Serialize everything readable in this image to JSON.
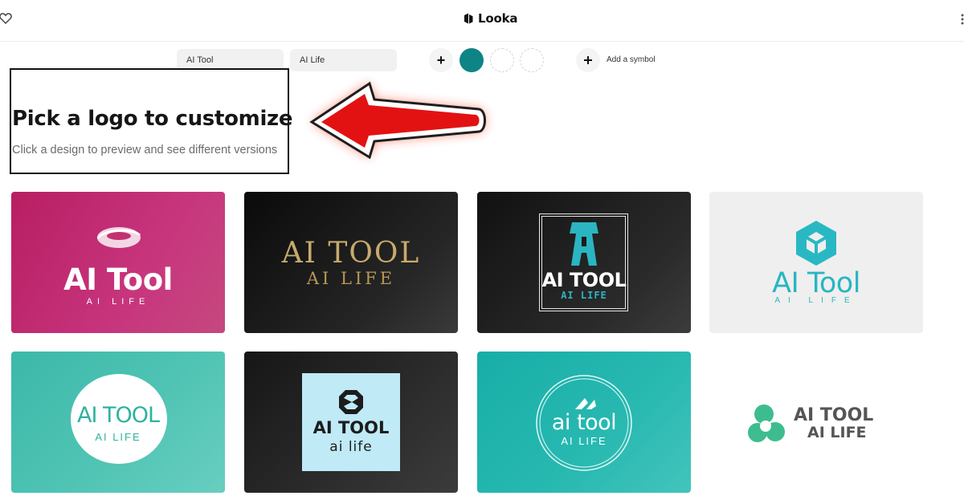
{
  "app": {
    "brand": "Looka"
  },
  "filters": {
    "company_name": "AI Tool",
    "slogan": "AI Life",
    "add_color_label": "+",
    "selected_color": "#0e8485",
    "add_symbol_label": "Add a symbol"
  },
  "heading": {
    "title": "Pick a logo to customize",
    "subtitle": "Click a design to preview and see different versions"
  },
  "annotation": {
    "arrow_color": "#e31212"
  },
  "logos": [
    {
      "name": "AI Tool",
      "tagline": "AI LIFE",
      "background": "#b81e62"
    },
    {
      "name": "AI TOOL",
      "tagline": "AI LIFE",
      "background": "#111111"
    },
    {
      "name": "AI TOOL",
      "tagline": "AI LIFE",
      "background": "#1a1a1a"
    },
    {
      "name": "AI Tool",
      "tagline": "AI LIFE",
      "background": "#efefef"
    },
    {
      "name": "AI TOOL",
      "tagline": "AI LIFE",
      "background": "#4ec3b3"
    },
    {
      "name": "AI TOOL",
      "tagline": "ai life",
      "background": "#222222"
    },
    {
      "name": "ai tool",
      "tagline": "AI LIFE",
      "background": "#28b9b1"
    },
    {
      "name": "AI TOOL",
      "tagline": "AI LIFE",
      "background": "#ffffff"
    }
  ]
}
